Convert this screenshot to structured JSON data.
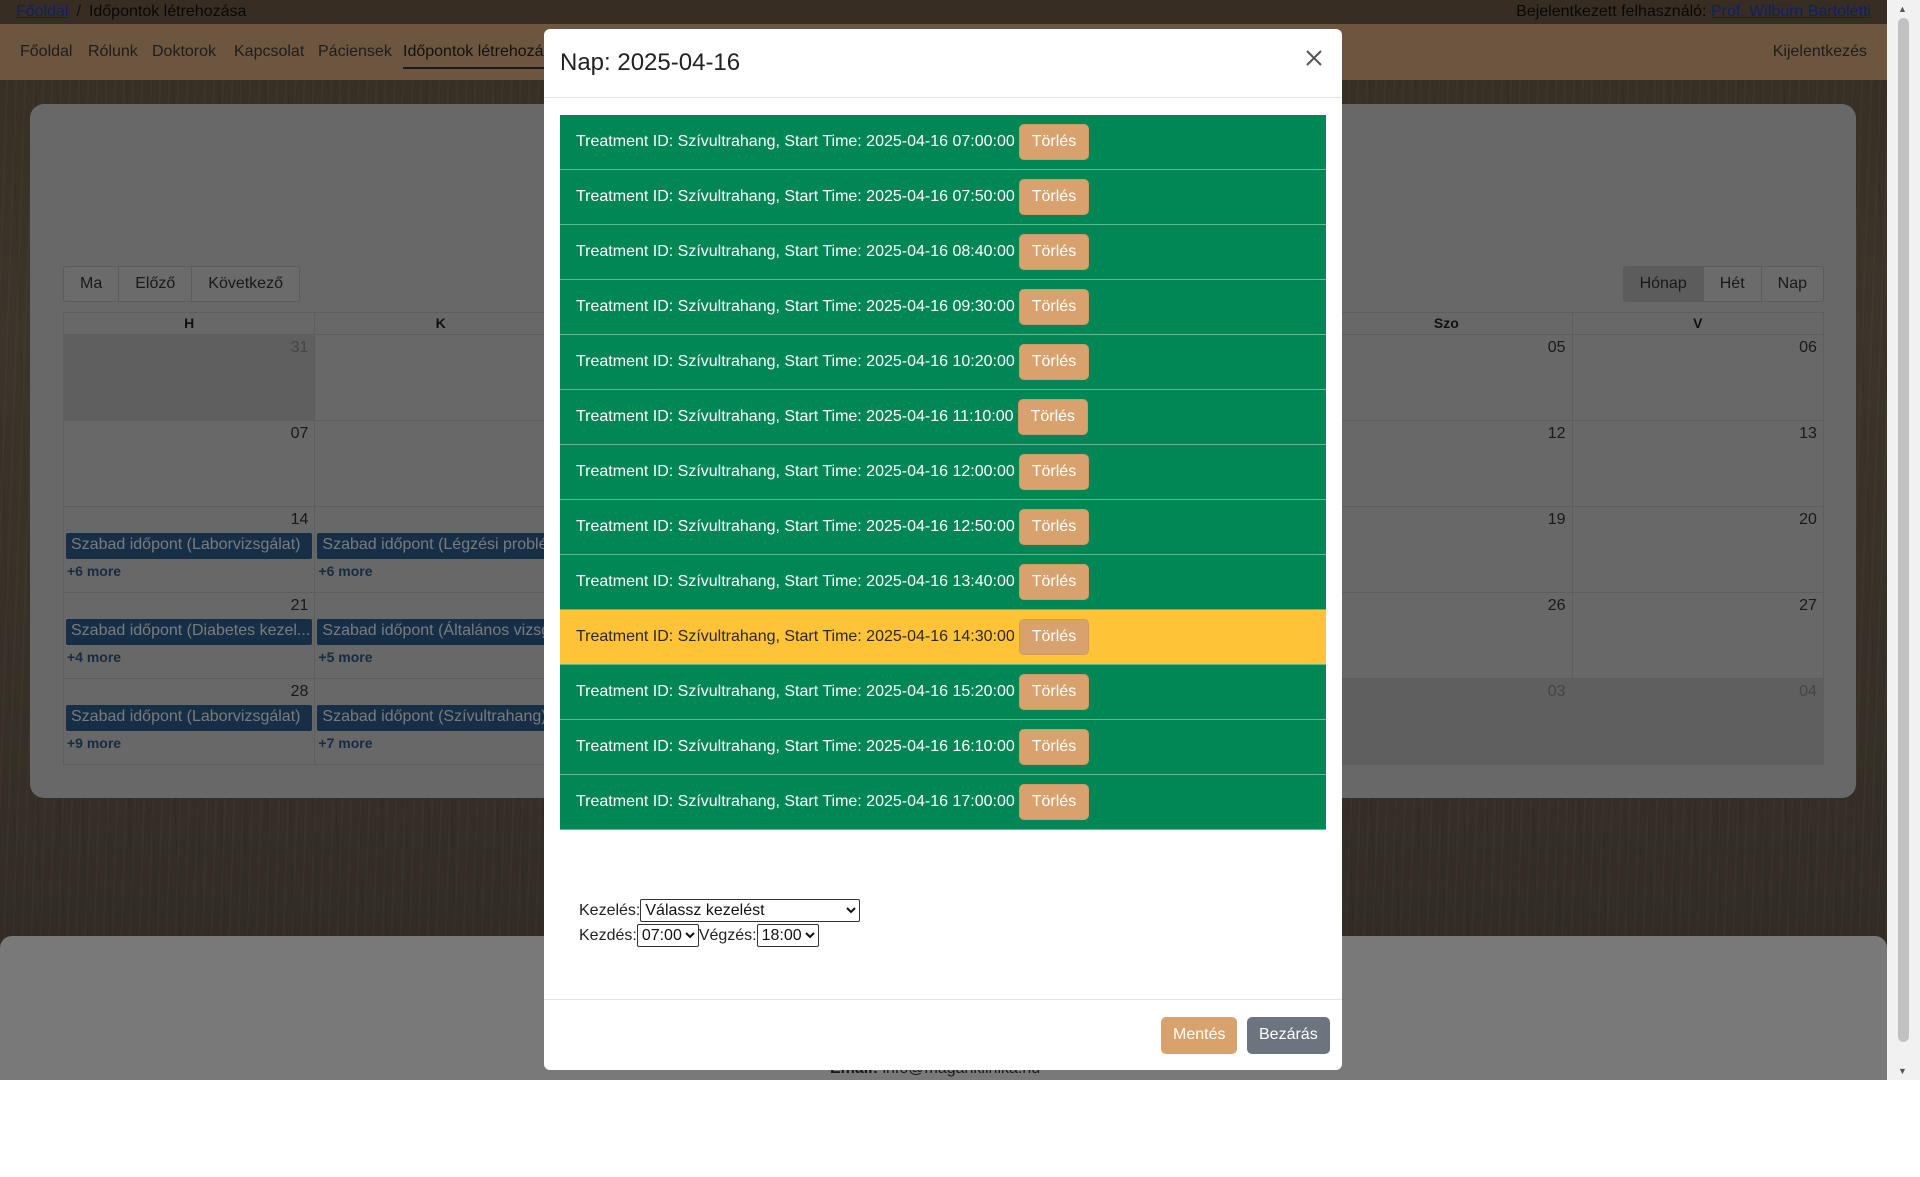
{
  "breadcrumb": {
    "home": "Főoldal",
    "separator": "/",
    "current": "Időpontok létrehozása"
  },
  "user": {
    "label": "Bejelentkezett felhasználó:",
    "name": "Prof. Wilburn Bartoletti"
  },
  "nav": {
    "items": [
      "Főoldal",
      "Rólunk",
      "Doktorok",
      "Kapcsolat",
      "Páciensek",
      "Időpontok létrehozá"
    ],
    "logout": "Kijelentkezés"
  },
  "calendar": {
    "nav_buttons": {
      "today": "Ma",
      "prev": "Előző",
      "next": "Következő"
    },
    "view_buttons": {
      "month": "Hónap",
      "week": "Hét",
      "day": "Nap"
    },
    "headers": [
      "H",
      "K",
      "",
      "",
      "",
      "Szo",
      "V"
    ],
    "weeks": [
      [
        {
          "day": "31",
          "other": true
        },
        {
          "day": ""
        },
        {
          "day": ""
        },
        {
          "day": ""
        },
        {
          "day": ""
        },
        {
          "day": "05"
        },
        {
          "day": "06"
        }
      ],
      [
        {
          "day": "07"
        },
        {
          "day": ""
        },
        {
          "day": ""
        },
        {
          "day": ""
        },
        {
          "day": ""
        },
        {
          "day": "12"
        },
        {
          "day": "13"
        }
      ],
      [
        {
          "day": "14",
          "event": "Szabad időpont (Laborvizsgálat)",
          "more": "+6 more"
        },
        {
          "day": "",
          "event": "Szabad időpont (Légzési problé",
          "more": "+6 more"
        },
        {
          "day": ""
        },
        {
          "day": ""
        },
        {
          "day": ""
        },
        {
          "day": "19"
        },
        {
          "day": "20"
        }
      ],
      [
        {
          "day": "21",
          "event": "Szabad időpont (Diabetes kezel...",
          "more": "+4 more"
        },
        {
          "day": "",
          "event": "Szabad időpont (Általános vizsg",
          "more": "+5 more"
        },
        {
          "day": ""
        },
        {
          "day": ""
        },
        {
          "day": ""
        },
        {
          "day": "26"
        },
        {
          "day": "27"
        }
      ],
      [
        {
          "day": "28",
          "event": "Szabad időpont (Laborvizsgálat)",
          "more": "+9 more"
        },
        {
          "day": "",
          "event": "Szabad időpont (Szívultrahang)",
          "more": "+7 more"
        },
        {
          "day": ""
        },
        {
          "day": ""
        },
        {
          "day": ""
        },
        {
          "day": "03",
          "other": true
        },
        {
          "day": "04",
          "other": true
        }
      ]
    ]
  },
  "footer": {
    "email_label": "Email:",
    "email": "info@magánklinika.hu"
  },
  "modal": {
    "title": "Nap: 2025-04-16",
    "delete_label": "Törlés",
    "slots": [
      {
        "text": "Treatment ID: Szívultrahang, Start Time: 2025-04-16 07:00:00",
        "highlight": false
      },
      {
        "text": "Treatment ID: Szívultrahang, Start Time: 2025-04-16 07:50:00",
        "highlight": false
      },
      {
        "text": "Treatment ID: Szívultrahang, Start Time: 2025-04-16 08:40:00",
        "highlight": false
      },
      {
        "text": "Treatment ID: Szívultrahang, Start Time: 2025-04-16 09:30:00",
        "highlight": false
      },
      {
        "text": "Treatment ID: Szívultrahang, Start Time: 2025-04-16 10:20:00",
        "highlight": false
      },
      {
        "text": "Treatment ID: Szívultrahang, Start Time: 2025-04-16 11:10:00",
        "highlight": false
      },
      {
        "text": "Treatment ID: Szívultrahang, Start Time: 2025-04-16 12:00:00",
        "highlight": false
      },
      {
        "text": "Treatment ID: Szívultrahang, Start Time: 2025-04-16 12:50:00",
        "highlight": false
      },
      {
        "text": "Treatment ID: Szívultrahang, Start Time: 2025-04-16 13:40:00",
        "highlight": false
      },
      {
        "text": "Treatment ID: Szívultrahang, Start Time: 2025-04-16 14:30:00",
        "highlight": true
      },
      {
        "text": "Treatment ID: Szívultrahang, Start Time: 2025-04-16 15:20:00",
        "highlight": false
      },
      {
        "text": "Treatment ID: Szívultrahang, Start Time: 2025-04-16 16:10:00",
        "highlight": false
      },
      {
        "text": "Treatment ID: Szívultrahang, Start Time: 2025-04-16 17:00:00",
        "highlight": false
      }
    ],
    "form": {
      "treatment_label": "Kezelés:",
      "treatment_value": "Válassz kezelést",
      "start_label": "Kezdés:",
      "start_value": "07:00",
      "end_label": "Végzés:",
      "end_value": "18:00"
    },
    "save_label": "Mentés",
    "close_label": "Bezárás"
  },
  "colors": {
    "slot_green": "#018755",
    "slot_highlight": "#fec337",
    "delete_button": "#d8a26e",
    "close_button": "#6c757d",
    "event_blue": "#2c5f8e",
    "navbar": "#d9ad7f"
  },
  "icons": {
    "close": "close-icon"
  }
}
